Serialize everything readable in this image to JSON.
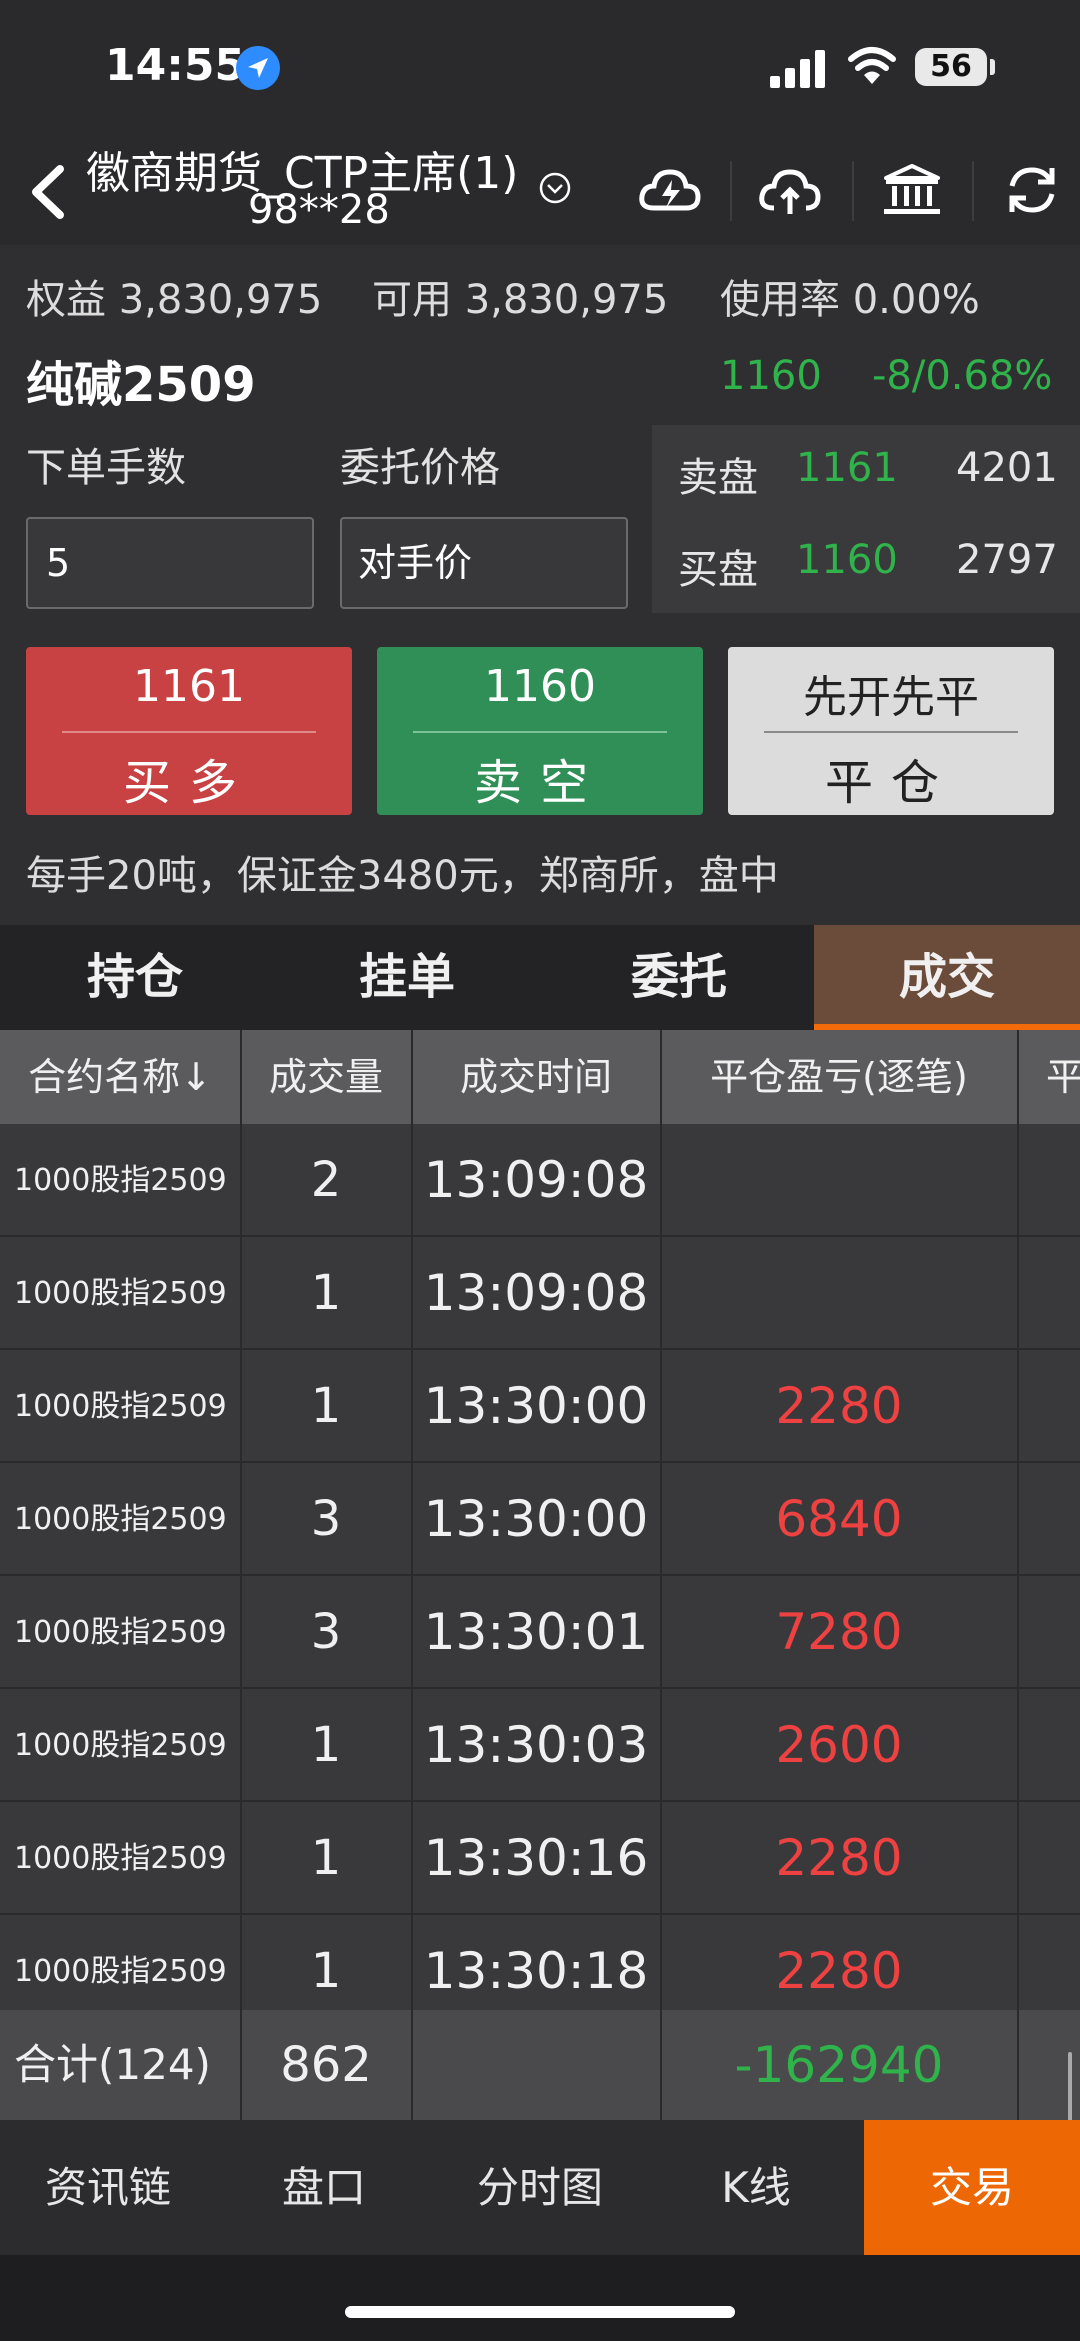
{
  "status": {
    "time": "14:55",
    "battery": "56"
  },
  "nav": {
    "title": "徽商期货_CTP主席(1)",
    "account": "98**28"
  },
  "account": {
    "equity_label": "权益",
    "equity": "3,830,975",
    "avail_label": "可用",
    "avail": "3,830,975",
    "usage_label": "使用率",
    "usage": "0.00%"
  },
  "instrument": {
    "name": "纯碱2509",
    "last": "1160",
    "change": "-8/0.68%"
  },
  "order": {
    "qty_label": "下单手数",
    "qty": "5",
    "price_label": "委托价格",
    "price_type": "对手价"
  },
  "book": {
    "ask_label": "卖盘",
    "ask_price": "1161",
    "ask_vol": "4201",
    "bid_label": "买盘",
    "bid_price": "1160",
    "bid_vol": "2797"
  },
  "buttons": {
    "buy_price": "1161",
    "buy_label": "买多",
    "sell_price": "1160",
    "sell_label": "卖空",
    "close_mode": "先开先平",
    "close_label": "平仓"
  },
  "info": "每手20吨，保证金3480元，郑商所，盘中",
  "tabs": [
    "持仓",
    "挂单",
    "委托",
    "成交"
  ],
  "table": {
    "headers": [
      "合约名称↓",
      "成交量",
      "成交时间",
      "平仓盈亏(逐笔)",
      "平"
    ],
    "rows": [
      {
        "name": "1000股指2509",
        "qty": "2",
        "time": "13:09:08",
        "pnl": ""
      },
      {
        "name": "1000股指2509",
        "qty": "1",
        "time": "13:09:08",
        "pnl": ""
      },
      {
        "name": "1000股指2509",
        "qty": "1",
        "time": "13:30:00",
        "pnl": "2280"
      },
      {
        "name": "1000股指2509",
        "qty": "3",
        "time": "13:30:00",
        "pnl": "6840"
      },
      {
        "name": "1000股指2509",
        "qty": "3",
        "time": "13:30:01",
        "pnl": "7280"
      },
      {
        "name": "1000股指2509",
        "qty": "1",
        "time": "13:30:03",
        "pnl": "2600"
      },
      {
        "name": "1000股指2509",
        "qty": "1",
        "time": "13:30:16",
        "pnl": "2280"
      },
      {
        "name": "1000股指2509",
        "qty": "1",
        "time": "13:30:18",
        "pnl": "2280"
      }
    ],
    "total": {
      "label": "合计(124)",
      "qty": "862",
      "pnl": "-162940"
    }
  },
  "bottom_nav": [
    "资讯链",
    "盘口",
    "分时图",
    "K线",
    "交易"
  ],
  "colors": {
    "buy": "#c84143",
    "sell": "#2f8f57",
    "close": "#dcdcdc",
    "accent": "#ee6705",
    "profit": "#ee4141",
    "loss": "#2fb34a"
  },
  "icons": [
    "location-arrow-icon",
    "signal-icon",
    "wifi-icon",
    "battery-icon",
    "back-icon",
    "chevron-down-icon",
    "cloud-lightning-icon",
    "cloud-upload-icon",
    "bank-icon",
    "refresh-icon"
  ]
}
